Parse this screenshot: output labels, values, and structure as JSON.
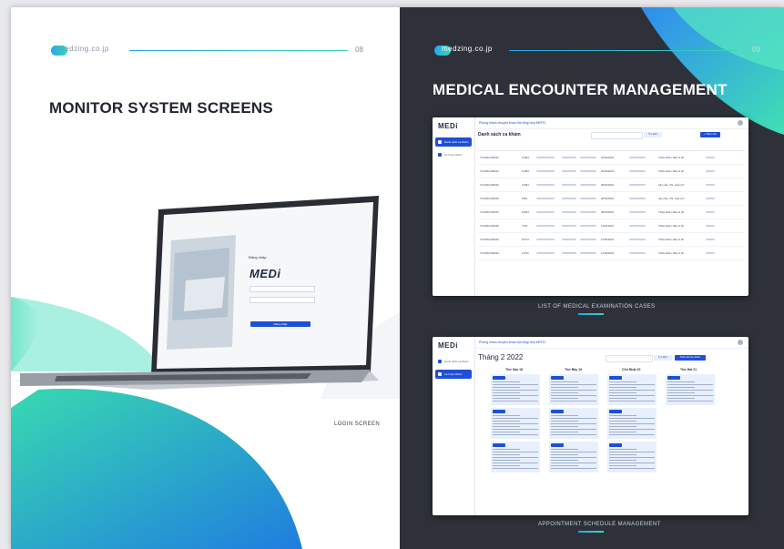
{
  "left_page": {
    "brand": "medzing.co.jp",
    "page_number": "08",
    "title": "MONITOR SYSTEM SCREENS",
    "caption": "LOGIN SCREEN",
    "login": {
      "heading": "Đăng nhập",
      "logo": "MEDi",
      "button": "Đăng nhập"
    }
  },
  "right_page": {
    "brand": "medzing.co.jp",
    "page_number": "09",
    "title": "MEDICAL ENCOUNTER MANAGEMENT",
    "caption_top": "LIST OF MEDICAL EXAMINATION CASES",
    "caption_bottom": "APPOINTMENT SCHEDULE MANAGEMENT",
    "shot1": {
      "logo": "MEDi",
      "clinic": "Phòng khám chuyên khoa Nội tổng hợp MEFIC",
      "heading": "Danh sách ca khám",
      "sidebar": [
        "Danh sách ca khám",
        "Lịch hẹn khám"
      ],
      "search_btn": "Tìm kiếm",
      "add_btn": "+ Thêm mới",
      "rows": [
        {
          "id": "TH.0302.000031",
          "code": "13484",
          "date": "22/02/2022",
          "service": "Thăm khám: Bác sĩ tới"
        },
        {
          "id": "TH.0302.000031",
          "code": "13484",
          "date": "22/02/2022",
          "service": "Thăm khám: Bác sĩ tới"
        },
        {
          "id": "TH.0302.000022",
          "code": "13484",
          "date": "28/02/2022",
          "service": "Lấy mẫu, XN: miễn phí"
        },
        {
          "id": "TH.0302.000020",
          "code": "1581",
          "date": "28/02/2022",
          "service": "Lấy mẫu, XN: miễn phí"
        },
        {
          "id": "TH.0302.000027",
          "code": "16994",
          "date": "28/02/2022",
          "service": "Thăm khám: Bác sĩ tới"
        },
        {
          "id": "TH.0302.000026",
          "code": "7724",
          "date": "14/02/2022",
          "service": "Thăm khám: Bác sĩ tới"
        },
        {
          "id": "TH.0302.000023",
          "code": "10724",
          "date": "14/02/2022",
          "service": "Thăm khám: Bác sĩ tới"
        },
        {
          "id": "TH.0302.000024",
          "code": "11794",
          "date": "14/02/2022",
          "service": "Thăm khám: Bác sĩ tới"
        }
      ]
    },
    "shot2": {
      "logo": "MEDi",
      "clinic": "Phòng khám chuyên khoa Nội tổng hợp MEFIC",
      "month": "Tháng 2 2022",
      "sidebar": [
        "Danh sách ca khám",
        "Lịch hẹn khám"
      ],
      "search_btn": "Tìm kiếm",
      "add_btn": "Thêm lịch hẹn khám",
      "days": [
        "Thứ Sáu 18",
        "Thứ Bảy 19",
        "Chủ Nhật 20",
        "Thứ Hai 21"
      ]
    }
  }
}
